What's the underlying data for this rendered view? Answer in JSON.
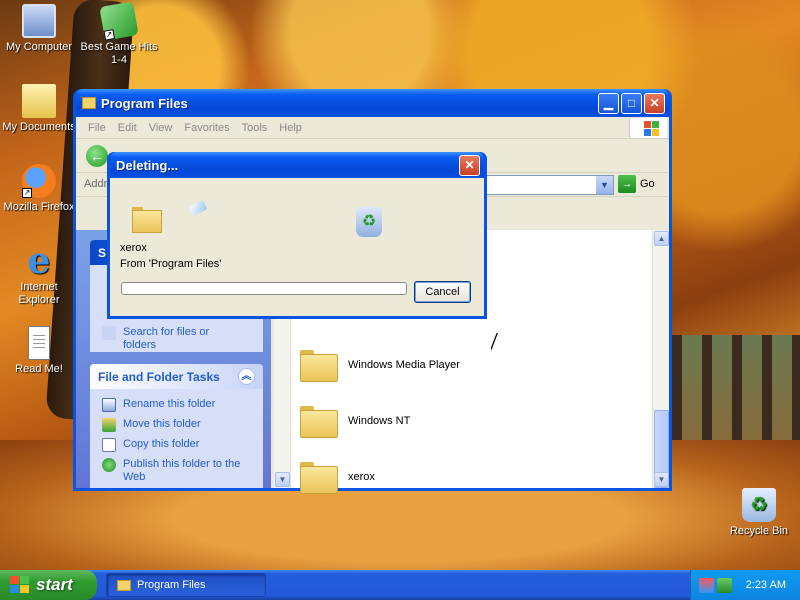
{
  "desktop": {
    "icons": [
      {
        "label": "My Computer",
        "icon": "my-computer-icon"
      },
      {
        "label": "Best Game Hits 1-4",
        "icon": "game-shortcut-icon"
      },
      {
        "label": "My Documents",
        "icon": "my-documents-icon"
      },
      {
        "label": "Mozilla Firefox",
        "icon": "firefox-icon"
      },
      {
        "label": "Internet Explorer",
        "icon": "internet-explorer-icon"
      },
      {
        "label": "Read Me!",
        "icon": "text-document-icon"
      },
      {
        "label": "Recycle Bin",
        "icon": "recycle-bin-icon"
      }
    ]
  },
  "explorer": {
    "title": "Program Files",
    "menu": [
      "File",
      "Edit",
      "View",
      "Favorites",
      "Tools",
      "Help"
    ],
    "address": {
      "label": "Addre",
      "go_label": "Go"
    },
    "taskpane": {
      "top_box_partial": [
        "Search for files or",
        "folders"
      ],
      "file_tasks": {
        "title": "File and Folder Tasks",
        "items": [
          "Rename this folder",
          "Move this folder",
          "Copy this folder",
          "Publish this folder to the Web"
        ]
      }
    },
    "files": [
      "Windows Media Player",
      "Windows NT",
      "xerox"
    ]
  },
  "dialog": {
    "title": "Deleting...",
    "item_name": "xerox",
    "from_text": "From 'Program Files'",
    "progress_fraction": 0.0,
    "cancel_label": "Cancel"
  },
  "taskbar": {
    "start_label": "start",
    "task_button_label": "Program Files",
    "clock": "2:23 AM"
  }
}
